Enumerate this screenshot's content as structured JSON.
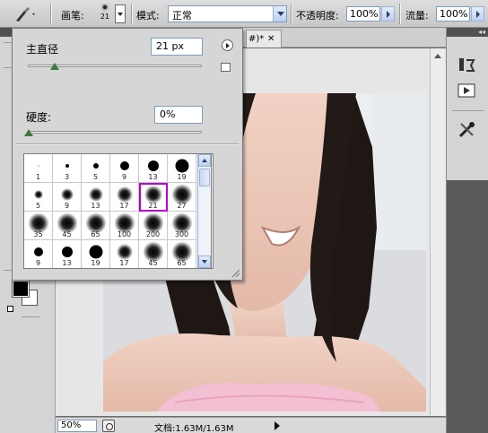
{
  "options_bar": {
    "brush_label": "画笔:",
    "brush_size": "21",
    "mode_label": "模式:",
    "mode_value": "正常",
    "opacity_label": "不透明度:",
    "opacity_value": "100%",
    "flow_label": "流量:",
    "flow_value": "100%"
  },
  "brush_picker": {
    "master_diameter_label": "主直径",
    "master_diameter_value": "21 px",
    "master_diameter_level": 0.07,
    "hardness_label": "硬度:",
    "hardness_value": "0%",
    "hardness_level": 0.0,
    "selected_brush": "21",
    "rows": [
      [
        {
          "size": "1",
          "hard": true
        },
        {
          "size": "3",
          "hard": true
        },
        {
          "size": "5",
          "hard": true
        },
        {
          "size": "9",
          "hard": true
        },
        {
          "size": "13",
          "hard": true
        },
        {
          "size": "19",
          "hard": true
        }
      ],
      [
        {
          "size": "5",
          "hard": false
        },
        {
          "size": "9",
          "hard": false
        },
        {
          "size": "13",
          "hard": false
        },
        {
          "size": "17",
          "hard": false
        },
        {
          "size": "21",
          "hard": false
        },
        {
          "size": "27",
          "hard": false
        }
      ],
      [
        {
          "size": "35",
          "hard": false
        },
        {
          "size": "45",
          "hard": false
        },
        {
          "size": "65",
          "hard": false
        },
        {
          "size": "100",
          "hard": false
        },
        {
          "size": "200",
          "hard": false
        },
        {
          "size": "300",
          "hard": false
        }
      ],
      [
        {
          "size": "9",
          "hard": true
        },
        {
          "size": "13",
          "hard": true
        },
        {
          "size": "19",
          "hard": true
        },
        {
          "size": "17",
          "hard": false
        },
        {
          "size": "45",
          "hard": false
        },
        {
          "size": "65",
          "hard": false
        }
      ]
    ]
  },
  "document": {
    "tab_title_fragment": "#)*"
  },
  "status_bar": {
    "zoom": "50%",
    "doc_info": "文档:1.63M/1.63M"
  },
  "colors": {
    "selection_outline": "#b000c8",
    "slider_thumb": "#3b7b3b",
    "input_border": "#7f9db9"
  },
  "icons": {
    "tool": "brush-tool-icon",
    "dock": [
      "history-icon",
      "actions-icon",
      "tools-preset-icon"
    ]
  }
}
